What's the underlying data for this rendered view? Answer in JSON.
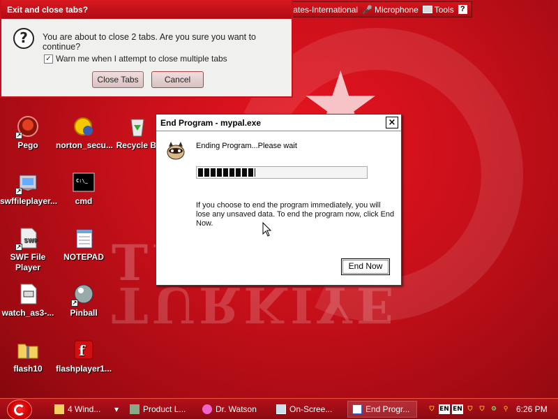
{
  "language_bar": {
    "language": "United States-International",
    "microphone": "Microphone",
    "tools": "Tools",
    "help": "?"
  },
  "close_tabs_dialog": {
    "title": "Exit and close tabs?",
    "message": "You are about to close 2 tabs. Are you sure you want to continue?",
    "checkbox_label": "Warn me when I attempt to close multiple tabs",
    "checkbox_checked": true,
    "close_button": "Close Tabs",
    "cancel_button": "Cancel"
  },
  "desktop": {
    "icons": [
      {
        "label": "Pego",
        "icon": "pego-icon"
      },
      {
        "label": "norton_secu...",
        "icon": "norton-icon"
      },
      {
        "label": "Recycle Bi",
        "icon": "recycle-bin-icon"
      },
      {
        "label": "swffileplayer...",
        "icon": "installer-icon"
      },
      {
        "label": "cmd",
        "icon": "cmd-icon"
      },
      {
        "label": "SWF File Player",
        "icon": "swf-file-icon"
      },
      {
        "label": "NOTEPAD",
        "icon": "notepad-icon"
      },
      {
        "label": "watch_as3-...",
        "icon": "html-file-icon"
      },
      {
        "label": "Pinball",
        "icon": "pinball-icon"
      },
      {
        "label": "flash10",
        "icon": "zip-folder-icon"
      },
      {
        "label": "flashplayer1...",
        "icon": "flash-icon"
      }
    ],
    "wallpaper_text": "TURKIYE"
  },
  "end_program_dialog": {
    "title": "End Program - mypal.exe",
    "close_glyph": "×",
    "status": "Ending Program...Please wait",
    "progress_fraction": 0.34,
    "message": "If you choose to end the program immediately, you will lose any unsaved data. To end the program now, click End Now.",
    "button": "End Now"
  },
  "taskbar": {
    "items": [
      {
        "label": "4 Wind...",
        "icon": "folder-icon"
      },
      {
        "label": "Product L...",
        "icon": "product-icon"
      },
      {
        "label": "Dr. Watson",
        "icon": "dr-watson-icon"
      },
      {
        "label": "On-Scree...",
        "icon": "keyboard-icon"
      },
      {
        "label": "End Progr...",
        "icon": "window-icon",
        "active": true
      }
    ],
    "tray": [
      "EN",
      "EN"
    ],
    "clock": "6:26 PM"
  }
}
